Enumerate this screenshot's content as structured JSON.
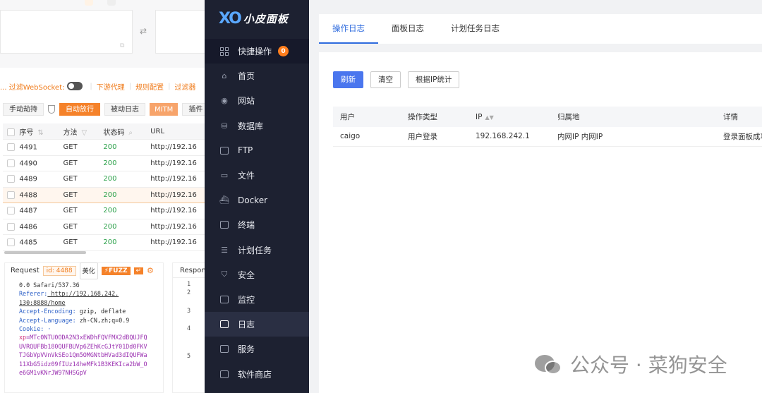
{
  "left_tool": {
    "filter_bar": {
      "filter_ws": "... 过滤WebSocket:",
      "upstream_proxy": "下游代理",
      "rule_config": "规则配置",
      "filter": "过滤器"
    },
    "tabs": {
      "manual": "手动劫持",
      "auto": "自动放行",
      "passive": "被动日志",
      "mitm": "MITM",
      "plugin": "插件"
    },
    "table": {
      "headers": [
        "序号",
        "方法",
        "状态码",
        "URL"
      ],
      "rows": [
        {
          "id": "4491",
          "method": "GET",
          "status": "200",
          "url": "http://192.16"
        },
        {
          "id": "4490",
          "method": "GET",
          "status": "200",
          "url": "http://192.16"
        },
        {
          "id": "4489",
          "method": "GET",
          "status": "200",
          "url": "http://192.16"
        },
        {
          "id": "4488",
          "method": "GET",
          "status": "200",
          "url": "http://192.16"
        },
        {
          "id": "4487",
          "method": "GET",
          "status": "200",
          "url": "http://192.16"
        },
        {
          "id": "4486",
          "method": "GET",
          "status": "200",
          "url": "http://192.16"
        },
        {
          "id": "4485",
          "method": "GET",
          "status": "200",
          "url": "http://192.16"
        }
      ],
      "selected_id": "4488"
    },
    "request": {
      "title": "Request",
      "id_label": "id: 4488",
      "beautify": "美化",
      "fuzz": "FUZZ",
      "lines": {
        "l1": "0.0 Safari/537.36",
        "referer_key": "Referer:",
        "referer_val": " http://192.168.242.",
        "referer_val2": "130:8888/home",
        "enc_key": "Accept-Encoding:",
        "enc_val": " gzip, deflate",
        "lang_key": "Accept-Language:",
        "lang_val": " zh-CN,zh;q=0.9",
        "cookie_key": "Cookie: ·",
        "c1_key": "xp",
        "c1": "=MTc0NTU0ODA2N3xEWDhFQVFMX2dBQUJFQ",
        "c2": "UVRQUFBb180QUFBUVp6ZEhKcGJtY01Dd0FKV",
        "c3": "TJGbVpVVnVkSEo1Qm5OMGNtbHVad3dIQUFWa",
        "c4": "11XbG5idz09fIUz14heMFk1B3KEKIca2bW_O",
        "c5": "e6GM1vKNrJW97NHSGpV"
      }
    },
    "response": {
      "title": "Respons",
      "line_numbers": [
        "1",
        "2",
        "3",
        "4",
        "5"
      ]
    }
  },
  "sidebar": {
    "logo_mark": "XO",
    "logo_name": "小皮面板",
    "items": [
      {
        "label": "快捷操作",
        "badge": "0"
      },
      {
        "label": "首页"
      },
      {
        "label": "网站"
      },
      {
        "label": "数据库"
      },
      {
        "label": "FTP"
      },
      {
        "label": "文件"
      },
      {
        "label": "Docker"
      },
      {
        "label": "终端"
      },
      {
        "label": "计划任务"
      },
      {
        "label": "安全"
      },
      {
        "label": "监控"
      },
      {
        "label": "日志"
      },
      {
        "label": "服务"
      },
      {
        "label": "软件商店"
      }
    ],
    "active": "日志"
  },
  "main": {
    "tabs": [
      "操作日志",
      "面板日志",
      "计划任务日志"
    ],
    "active_tab": "操作日志",
    "buttons": {
      "refresh": "刷新",
      "clear": "清空",
      "ip_stats": "根据IP统计"
    },
    "table": {
      "headers": [
        "用户",
        "操作类型",
        "IP",
        "归属地",
        "详情"
      ],
      "rows": [
        {
          "user": "caigo",
          "type": "用户登录",
          "ip": "192.168.242.1",
          "location": "内网IP 内网IP",
          "detail": "登录面板成功"
        }
      ]
    }
  },
  "watermark": "公众号 · 菜狗安全",
  "colors": {
    "sidebar_bg": "#1d2131",
    "accent_blue": "#4a76ee",
    "orange": "#f5822a",
    "badge": "#ff7e1d"
  }
}
